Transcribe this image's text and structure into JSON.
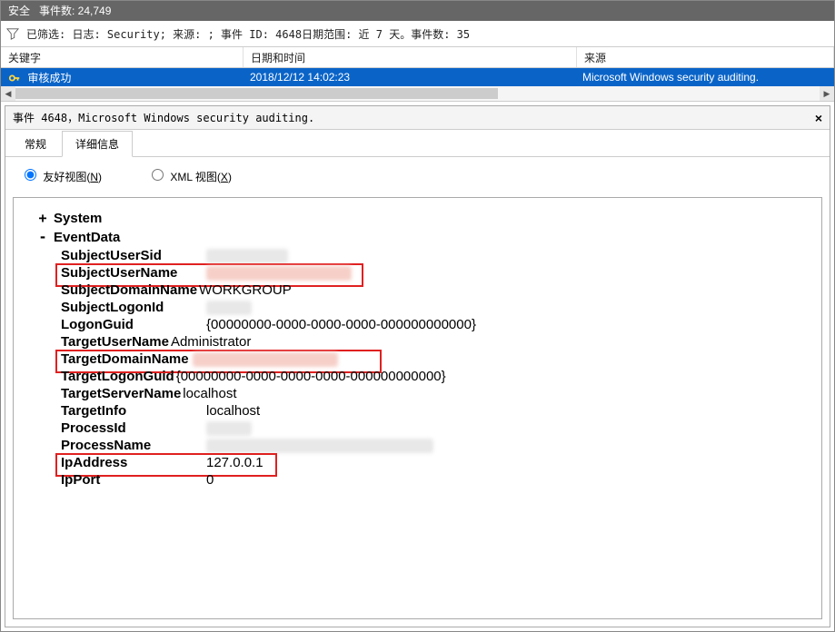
{
  "titlebar": {
    "label_security": "安全",
    "label_event_count": "事件数: 24,749"
  },
  "filter": {
    "text": "已筛选: 日志: Security; 来源: ; 事件 ID: 4648日期范围: 近 7 天。事件数: 35"
  },
  "table": {
    "headers": {
      "keyword": "关键字",
      "datetime": "日期和时间",
      "source": "来源"
    },
    "row": {
      "keyword": "审核成功",
      "datetime": "2018/12/12 14:02:23",
      "source": "Microsoft Windows security auditing."
    }
  },
  "detail": {
    "title": "事件 4648，Microsoft Windows security auditing."
  },
  "tabs": {
    "general": "常规",
    "details": "详细信息"
  },
  "viewmode": {
    "friendly_pre": "友好视图(",
    "friendly_key": "N",
    "friendly_post": ")",
    "xml_pre": "XML 视图(",
    "xml_key": "X",
    "xml_post": ")"
  },
  "tree": {
    "system_label": "System",
    "eventdata_label": "EventData",
    "rows": {
      "SubjectUserSid": {
        "name": "SubjectUserSid",
        "value": ""
      },
      "SubjectUserName": {
        "name": "SubjectUserName",
        "value": ""
      },
      "SubjectDomainName": {
        "name": "SubjectDomainName",
        "value": "WORKGROUP"
      },
      "SubjectLogonId": {
        "name": "SubjectLogonId",
        "value": ""
      },
      "LogonGuid": {
        "name": "LogonGuid",
        "value": "{00000000-0000-0000-0000-000000000000}"
      },
      "TargetUserName": {
        "name": "TargetUserName",
        "value": "Administrator"
      },
      "TargetDomainName": {
        "name": "TargetDomainName",
        "value": ""
      },
      "TargetLogonGuid": {
        "name": "TargetLogonGuid",
        "value": "{00000000-0000-0000-0000-000000000000}"
      },
      "TargetServerName": {
        "name": "TargetServerName",
        "value": "localhost"
      },
      "TargetInfo": {
        "name": "TargetInfo",
        "value": "localhost"
      },
      "ProcessId": {
        "name": "ProcessId",
        "value": ""
      },
      "ProcessName": {
        "name": "ProcessName",
        "value": ""
      },
      "IpAddress": {
        "name": "IpAddress",
        "value": "127.0.0.1"
      },
      "IpPort": {
        "name": "IpPort",
        "value": "0"
      }
    }
  }
}
